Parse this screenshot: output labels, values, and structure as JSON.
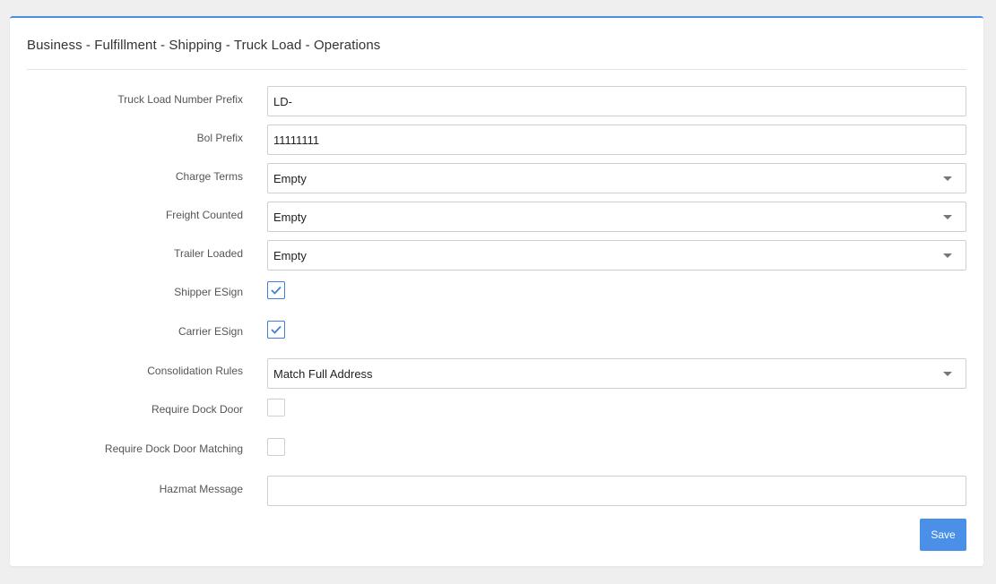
{
  "panel": {
    "title": "Business - Fulfillment - Shipping - Truck Load - Operations"
  },
  "form": {
    "truck_load_number_prefix": {
      "label": "Truck Load Number Prefix",
      "value": "LD-"
    },
    "bol_prefix": {
      "label": "Bol Prefix",
      "value": "11111111"
    },
    "charge_terms": {
      "label": "Charge Terms",
      "value": "Empty"
    },
    "freight_counted": {
      "label": "Freight Counted",
      "value": "Empty"
    },
    "trailer_loaded": {
      "label": "Trailer Loaded",
      "value": "Empty"
    },
    "shipper_esign": {
      "label": "Shipper ESign",
      "checked": true
    },
    "carrier_esign": {
      "label": "Carrier ESign",
      "checked": true
    },
    "consolidation_rules": {
      "label": "Consolidation Rules",
      "value": "Match Full Address"
    },
    "require_dock_door": {
      "label": "Require Dock Door",
      "checked": false
    },
    "require_dock_door_matching": {
      "label": "Require Dock Door Matching",
      "checked": false
    },
    "hazmat_message": {
      "label": "Hazmat Message",
      "value": ""
    }
  },
  "actions": {
    "save_label": "Save"
  },
  "colors": {
    "accent": "#4a8fe8",
    "check": "#3f7fd8"
  },
  "icons": {
    "select_caret": "chevron-down-icon",
    "checkmark": "checkmark-icon"
  }
}
